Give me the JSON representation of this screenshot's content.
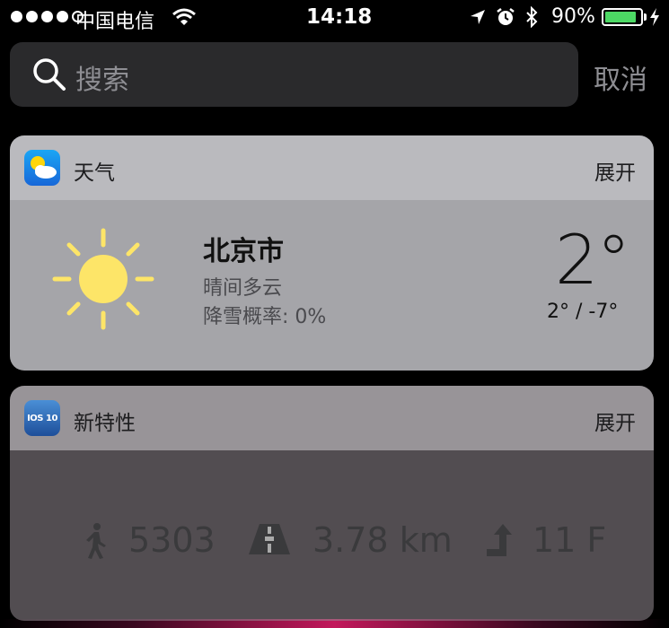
{
  "status_bar": {
    "carrier": "中国电信",
    "time": "14:18",
    "battery_percent": "90%",
    "battery_level": 0.9
  },
  "search": {
    "placeholder": "搜索",
    "cancel_label": "取消"
  },
  "weather_widget": {
    "app_name": "天气",
    "expand_label": "展开",
    "city": "北京市",
    "condition": "晴间多云",
    "snow_chance": "降雪概率: 0%",
    "temperature": "2°",
    "range": "2° / -7°"
  },
  "features_widget": {
    "app_name": "新特性",
    "app_icon_label": "IOS 10",
    "expand_label": "展开",
    "steps": "5303",
    "distance": "3.78 km",
    "floors": "11 F"
  }
}
